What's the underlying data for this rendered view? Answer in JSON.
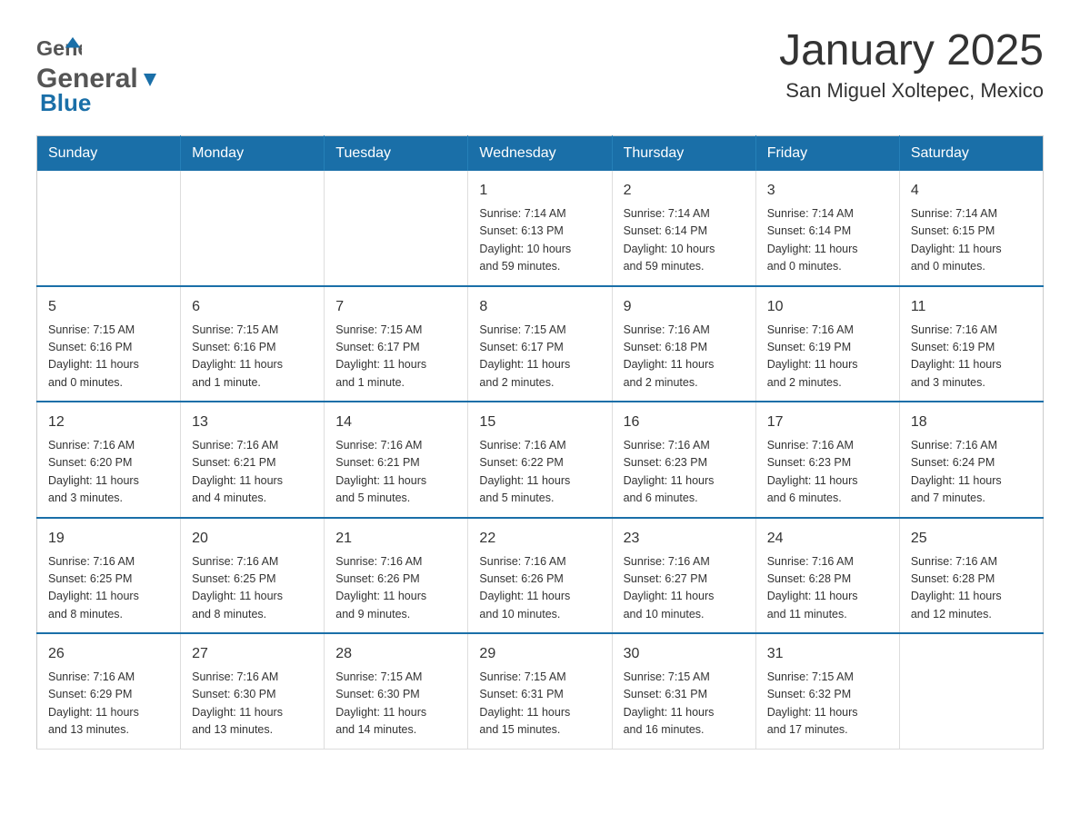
{
  "header": {
    "logo_general": "General",
    "logo_blue": "Blue",
    "title": "January 2025",
    "subtitle": "San Miguel Xoltepec, Mexico"
  },
  "calendar": {
    "days_of_week": [
      "Sunday",
      "Monday",
      "Tuesday",
      "Wednesday",
      "Thursday",
      "Friday",
      "Saturday"
    ],
    "weeks": [
      [
        {
          "num": "",
          "info": ""
        },
        {
          "num": "",
          "info": ""
        },
        {
          "num": "",
          "info": ""
        },
        {
          "num": "1",
          "info": "Sunrise: 7:14 AM\nSunset: 6:13 PM\nDaylight: 10 hours\nand 59 minutes."
        },
        {
          "num": "2",
          "info": "Sunrise: 7:14 AM\nSunset: 6:14 PM\nDaylight: 10 hours\nand 59 minutes."
        },
        {
          "num": "3",
          "info": "Sunrise: 7:14 AM\nSunset: 6:14 PM\nDaylight: 11 hours\nand 0 minutes."
        },
        {
          "num": "4",
          "info": "Sunrise: 7:14 AM\nSunset: 6:15 PM\nDaylight: 11 hours\nand 0 minutes."
        }
      ],
      [
        {
          "num": "5",
          "info": "Sunrise: 7:15 AM\nSunset: 6:16 PM\nDaylight: 11 hours\nand 0 minutes."
        },
        {
          "num": "6",
          "info": "Sunrise: 7:15 AM\nSunset: 6:16 PM\nDaylight: 11 hours\nand 1 minute."
        },
        {
          "num": "7",
          "info": "Sunrise: 7:15 AM\nSunset: 6:17 PM\nDaylight: 11 hours\nand 1 minute."
        },
        {
          "num": "8",
          "info": "Sunrise: 7:15 AM\nSunset: 6:17 PM\nDaylight: 11 hours\nand 2 minutes."
        },
        {
          "num": "9",
          "info": "Sunrise: 7:16 AM\nSunset: 6:18 PM\nDaylight: 11 hours\nand 2 minutes."
        },
        {
          "num": "10",
          "info": "Sunrise: 7:16 AM\nSunset: 6:19 PM\nDaylight: 11 hours\nand 2 minutes."
        },
        {
          "num": "11",
          "info": "Sunrise: 7:16 AM\nSunset: 6:19 PM\nDaylight: 11 hours\nand 3 minutes."
        }
      ],
      [
        {
          "num": "12",
          "info": "Sunrise: 7:16 AM\nSunset: 6:20 PM\nDaylight: 11 hours\nand 3 minutes."
        },
        {
          "num": "13",
          "info": "Sunrise: 7:16 AM\nSunset: 6:21 PM\nDaylight: 11 hours\nand 4 minutes."
        },
        {
          "num": "14",
          "info": "Sunrise: 7:16 AM\nSunset: 6:21 PM\nDaylight: 11 hours\nand 5 minutes."
        },
        {
          "num": "15",
          "info": "Sunrise: 7:16 AM\nSunset: 6:22 PM\nDaylight: 11 hours\nand 5 minutes."
        },
        {
          "num": "16",
          "info": "Sunrise: 7:16 AM\nSunset: 6:23 PM\nDaylight: 11 hours\nand 6 minutes."
        },
        {
          "num": "17",
          "info": "Sunrise: 7:16 AM\nSunset: 6:23 PM\nDaylight: 11 hours\nand 6 minutes."
        },
        {
          "num": "18",
          "info": "Sunrise: 7:16 AM\nSunset: 6:24 PM\nDaylight: 11 hours\nand 7 minutes."
        }
      ],
      [
        {
          "num": "19",
          "info": "Sunrise: 7:16 AM\nSunset: 6:25 PM\nDaylight: 11 hours\nand 8 minutes."
        },
        {
          "num": "20",
          "info": "Sunrise: 7:16 AM\nSunset: 6:25 PM\nDaylight: 11 hours\nand 8 minutes."
        },
        {
          "num": "21",
          "info": "Sunrise: 7:16 AM\nSunset: 6:26 PM\nDaylight: 11 hours\nand 9 minutes."
        },
        {
          "num": "22",
          "info": "Sunrise: 7:16 AM\nSunset: 6:26 PM\nDaylight: 11 hours\nand 10 minutes."
        },
        {
          "num": "23",
          "info": "Sunrise: 7:16 AM\nSunset: 6:27 PM\nDaylight: 11 hours\nand 10 minutes."
        },
        {
          "num": "24",
          "info": "Sunrise: 7:16 AM\nSunset: 6:28 PM\nDaylight: 11 hours\nand 11 minutes."
        },
        {
          "num": "25",
          "info": "Sunrise: 7:16 AM\nSunset: 6:28 PM\nDaylight: 11 hours\nand 12 minutes."
        }
      ],
      [
        {
          "num": "26",
          "info": "Sunrise: 7:16 AM\nSunset: 6:29 PM\nDaylight: 11 hours\nand 13 minutes."
        },
        {
          "num": "27",
          "info": "Sunrise: 7:16 AM\nSunset: 6:30 PM\nDaylight: 11 hours\nand 13 minutes."
        },
        {
          "num": "28",
          "info": "Sunrise: 7:15 AM\nSunset: 6:30 PM\nDaylight: 11 hours\nand 14 minutes."
        },
        {
          "num": "29",
          "info": "Sunrise: 7:15 AM\nSunset: 6:31 PM\nDaylight: 11 hours\nand 15 minutes."
        },
        {
          "num": "30",
          "info": "Sunrise: 7:15 AM\nSunset: 6:31 PM\nDaylight: 11 hours\nand 16 minutes."
        },
        {
          "num": "31",
          "info": "Sunrise: 7:15 AM\nSunset: 6:32 PM\nDaylight: 11 hours\nand 17 minutes."
        },
        {
          "num": "",
          "info": ""
        }
      ]
    ]
  }
}
